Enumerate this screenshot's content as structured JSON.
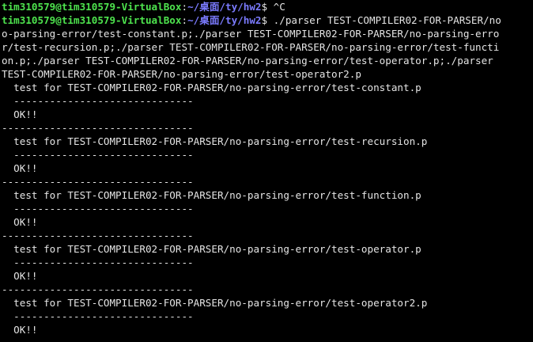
{
  "prompt": {
    "user_host": "tim310579@tim310579-VirtualBox",
    "sep": ":",
    "cwd": "~/桌面/ty/hw2",
    "symbol": "$ "
  },
  "lines": [
    {
      "kind": "prompt",
      "cmd": "^C"
    },
    {
      "kind": "prompt",
      "cmd": "./parser TEST-COMPILER02-FOR-PARSER/no"
    },
    {
      "kind": "text",
      "text": "o-parsing-error/test-constant.p;./parser TEST-COMPILER02-FOR-PARSER/no-parsing-erro"
    },
    {
      "kind": "text",
      "text": "r/test-recursion.p;./parser TEST-COMPILER02-FOR-PARSER/no-parsing-error/test-functi"
    },
    {
      "kind": "text",
      "text": "on.p;./parser TEST-COMPILER02-FOR-PARSER/no-parsing-error/test-operator.p;./parser"
    },
    {
      "kind": "text",
      "text": "TEST-COMPILER02-FOR-PARSER/no-parsing-error/test-operator2.p"
    },
    {
      "kind": "text",
      "text": "  test for TEST-COMPILER02-FOR-PARSER/no-parsing-error/test-constant.p"
    },
    {
      "kind": "text",
      "text": "  ------------------------------"
    },
    {
      "kind": "text",
      "text": "  OK!!"
    },
    {
      "kind": "text",
      "text": "--------------------------------"
    },
    {
      "kind": "text",
      "text": "  test for TEST-COMPILER02-FOR-PARSER/no-parsing-error/test-recursion.p"
    },
    {
      "kind": "text",
      "text": "  ------------------------------"
    },
    {
      "kind": "text",
      "text": "  OK!!"
    },
    {
      "kind": "text",
      "text": "--------------------------------"
    },
    {
      "kind": "text",
      "text": "  test for TEST-COMPILER02-FOR-PARSER/no-parsing-error/test-function.p"
    },
    {
      "kind": "text",
      "text": "  ------------------------------"
    },
    {
      "kind": "text",
      "text": "  OK!!"
    },
    {
      "kind": "text",
      "text": "--------------------------------"
    },
    {
      "kind": "text",
      "text": "  test for TEST-COMPILER02-FOR-PARSER/no-parsing-error/test-operator.p"
    },
    {
      "kind": "text",
      "text": "  ------------------------------"
    },
    {
      "kind": "text",
      "text": "  OK!!"
    },
    {
      "kind": "text",
      "text": "--------------------------------"
    },
    {
      "kind": "text",
      "text": "  test for TEST-COMPILER02-FOR-PARSER/no-parsing-error/test-operator2.p"
    },
    {
      "kind": "text",
      "text": "  ------------------------------"
    },
    {
      "kind": "text",
      "text": "  OK!!"
    }
  ],
  "colors": {
    "background": "#000000",
    "foreground": "#e5e5e5",
    "user_host": "#4ee44e",
    "cwd": "#7b7bff"
  }
}
